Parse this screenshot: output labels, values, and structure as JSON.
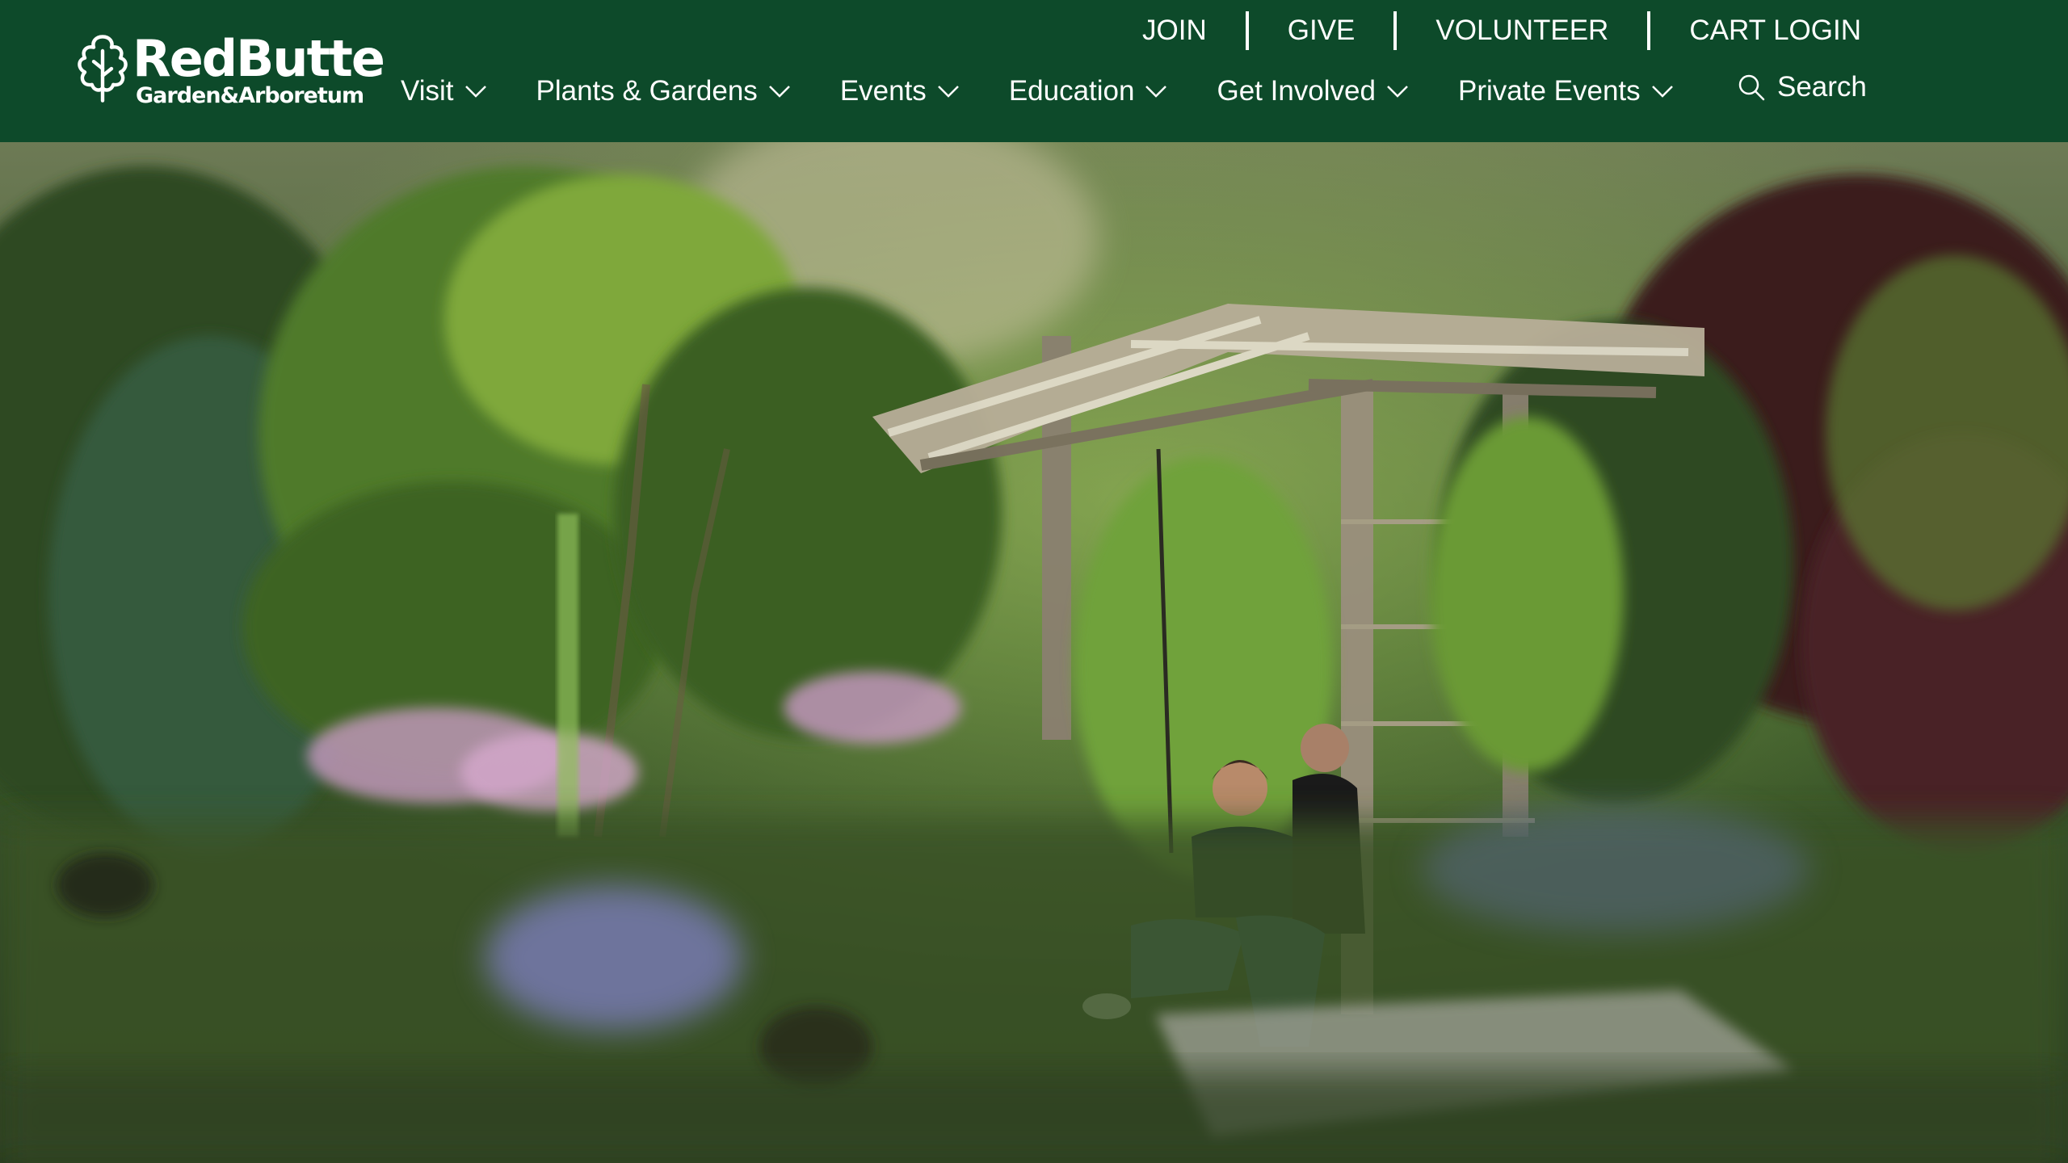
{
  "brand": {
    "name": "RedButte",
    "subtitle": "Garden&Arboretum"
  },
  "utility_nav": [
    "JOIN",
    "GIVE",
    "VOLUNTEER",
    "CART LOGIN"
  ],
  "main_nav": [
    {
      "label": "Visit"
    },
    {
      "label": "Plants & Gardens"
    },
    {
      "label": "Events"
    },
    {
      "label": "Education"
    },
    {
      "label": "Get Involved"
    },
    {
      "label": "Private Events"
    }
  ],
  "search": {
    "label": "Search"
  },
  "colors": {
    "header_bg": "#0d4a2a",
    "text": "#ffffff"
  },
  "icons": {
    "logo": "oak-leaf-icon",
    "nav_chevron": "chevron-down-icon",
    "search": "search-icon"
  }
}
